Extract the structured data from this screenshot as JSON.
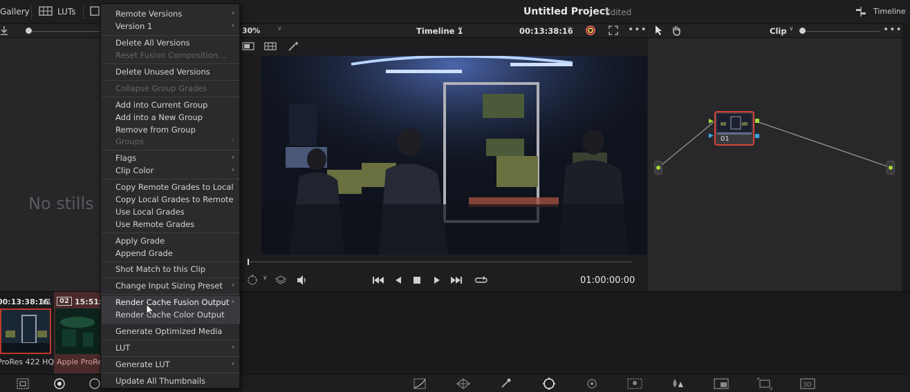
{
  "topbar": {
    "gallery_label": "Gallery",
    "luts_label": "LUTs",
    "project_title": "Untitled Project",
    "project_status": "Edited",
    "timeline_label": "Timeline"
  },
  "viewer": {
    "zoom": "30%",
    "timeline_name": "Timeline 1",
    "source_timecode": "00:13:38:16",
    "playhead_timecode": "01:00:00:00",
    "clip_mode": "Clip"
  },
  "gallery": {
    "empty_text": "No stills"
  },
  "nodes": {
    "node_label": "01"
  },
  "clips": {
    "timecode_1": "00:13:38:16",
    "track_1": "V1",
    "clip_number_2": "02",
    "timecode_2": "15:51:5",
    "codec_1": "ProRes 422 HQ",
    "codec_2": "Apple ProRe"
  },
  "context_menu": {
    "items": [
      {
        "label": "Remote Versions",
        "submenu": true,
        "disabled": false
      },
      {
        "label": "Version 1",
        "submenu": true,
        "disabled": false
      },
      {
        "label": "Delete All Versions",
        "submenu": false,
        "disabled": false
      },
      {
        "label": "Reset Fusion Composition...",
        "submenu": false,
        "disabled": true
      },
      {
        "label": "Delete Unused Versions",
        "submenu": false,
        "disabled": false
      },
      {
        "label": "Collapse Group Grades",
        "submenu": false,
        "disabled": true
      },
      {
        "label": "Add into Current Group",
        "submenu": false,
        "disabled": false
      },
      {
        "label": "Add into a New Group",
        "submenu": false,
        "disabled": false
      },
      {
        "label": "Remove from Group",
        "submenu": false,
        "disabled": false
      },
      {
        "label": "Groups",
        "submenu": true,
        "disabled": true
      },
      {
        "label": "Flags",
        "submenu": true,
        "disabled": false
      },
      {
        "label": "Clip Color",
        "submenu": true,
        "disabled": false
      },
      {
        "label": "Copy Remote Grades to Local",
        "submenu": false,
        "disabled": false
      },
      {
        "label": "Copy Local Grades to Remote",
        "submenu": false,
        "disabled": false
      },
      {
        "label": "Use Local Grades",
        "submenu": false,
        "disabled": false
      },
      {
        "label": "Use Remote Grades",
        "submenu": false,
        "disabled": false
      },
      {
        "label": "Apply Grade",
        "submenu": false,
        "disabled": false
      },
      {
        "label": "Append Grade",
        "submenu": false,
        "disabled": false
      },
      {
        "label": "Shot Match to this Clip",
        "submenu": false,
        "disabled": false
      },
      {
        "label": "Change Input Sizing Preset",
        "submenu": true,
        "disabled": false
      },
      {
        "label": "Render Cache Fusion Output",
        "submenu": true,
        "disabled": false
      },
      {
        "label": "Render Cache Color Output",
        "submenu": false,
        "disabled": false
      },
      {
        "label": "Generate Optimized Media",
        "submenu": false,
        "disabled": false
      },
      {
        "label": "LUT",
        "submenu": true,
        "disabled": false
      },
      {
        "label": "Generate LUT",
        "submenu": true,
        "disabled": false
      },
      {
        "label": "Update All Thumbnails",
        "submenu": false,
        "disabled": false
      }
    ]
  },
  "colors": {
    "accent_green": "#a6d93a",
    "node_selected_border": "#d9453a",
    "clip_selected_border": "#c0392b",
    "highlight_bg": "#3a3a3e"
  }
}
